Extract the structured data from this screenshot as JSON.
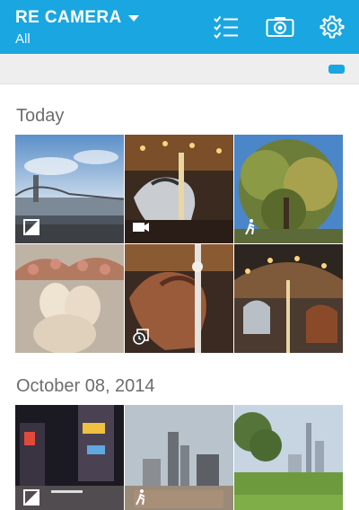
{
  "app": {
    "title": "RE CAMERA",
    "subtitle": "All"
  },
  "toolbar": {
    "icons": [
      "checklist-icon",
      "camera-icon",
      "settings-icon"
    ]
  },
  "colors": {
    "accent": "#1aa6e0",
    "subbar": "#eeeeee",
    "section_text": "#6d6d6d"
  },
  "sections": [
    {
      "label": "Today",
      "photos": [
        {
          "subject": "bridge over river",
          "badge": "hdr-off-icon"
        },
        {
          "subject": "carousel horse",
          "badge": "video-icon"
        },
        {
          "subject": "tree and sky",
          "badge": "walking-icon"
        },
        {
          "subject": "cherub sculpture",
          "badge": ""
        },
        {
          "subject": "carousel horse close-up",
          "badge": "timelapse-icon"
        },
        {
          "subject": "carousel fisheye",
          "badge": ""
        }
      ]
    },
    {
      "label": "October 08, 2014",
      "photos": [
        {
          "subject": "city street at night",
          "badge": "hdr-off-icon"
        },
        {
          "subject": "city skyline",
          "badge": "walking-icon"
        },
        {
          "subject": "park and skyline",
          "badge": ""
        }
      ]
    }
  ]
}
